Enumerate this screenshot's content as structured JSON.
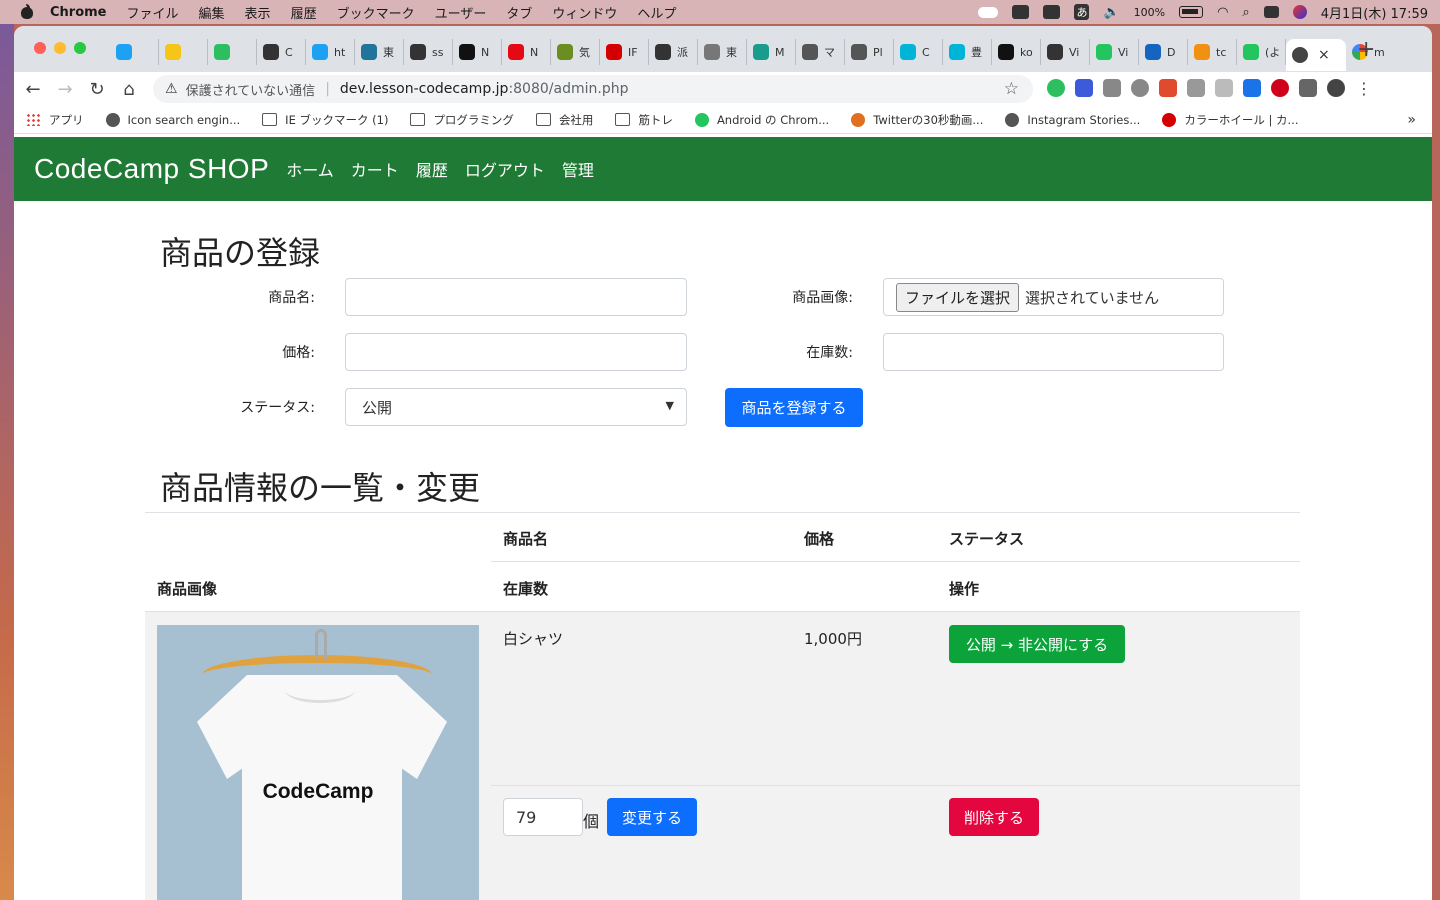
{
  "menubar": {
    "app": "Chrome",
    "items": [
      "ファイル",
      "編集",
      "表示",
      "履歴",
      "ブックマーク",
      "ユーザー",
      "タブ",
      "ウィンドウ",
      "ヘルプ"
    ],
    "battery": "100%",
    "ime": "あ",
    "clock": "4月1日(木) 17:59"
  },
  "tabs": [
    {
      "label": "",
      "icon": "twitter-icon",
      "color": "#1da1f2"
    },
    {
      "label": "",
      "icon": "notes-icon",
      "color": "#f5c518"
    },
    {
      "label": "",
      "icon": "evernote-icon",
      "color": "#2dbe60"
    },
    {
      "label": "C",
      "icon": "circle-icon",
      "color": "#333"
    },
    {
      "label": "ht",
      "icon": "twitter-icon",
      "color": "#1da1f2"
    },
    {
      "label": "東",
      "icon": "wordpress-icon",
      "color": "#21759b"
    },
    {
      "label": "ss",
      "icon": "book-icon",
      "color": "#333"
    },
    {
      "label": "N",
      "icon": "notion-icon",
      "color": "#111"
    },
    {
      "label": "N",
      "icon": "netflix-icon",
      "color": "#e50914"
    },
    {
      "label": "気",
      "icon": "weather-icon",
      "color": "#6b8e23"
    },
    {
      "label": "IF",
      "icon": "ipa-icon",
      "color": "#d40000"
    },
    {
      "label": "派",
      "icon": "t-icon",
      "color": "#333"
    },
    {
      "label": "東",
      "icon": "flag-icon",
      "color": "#777"
    },
    {
      "label": "M",
      "icon": "m-icon",
      "color": "#1a9c8c"
    },
    {
      "label": "マ",
      "icon": "globe-icon",
      "color": "#555"
    },
    {
      "label": "Pl",
      "icon": "globe-icon",
      "color": "#555"
    },
    {
      "label": "C",
      "icon": "codecamp-icon",
      "color": "#00b4d8"
    },
    {
      "label": "豊",
      "icon": "codecamp-icon",
      "color": "#00b4d8"
    },
    {
      "label": "ko",
      "icon": "github-icon",
      "color": "#111"
    },
    {
      "label": "Vi",
      "icon": "bug-icon",
      "color": "#333"
    },
    {
      "label": "Vi",
      "icon": "line-icon",
      "color": "#22c55e"
    },
    {
      "label": "D",
      "icon": "chart-icon",
      "color": "#1565c0"
    },
    {
      "label": "tc",
      "icon": "pma-icon",
      "color": "#f29111"
    },
    {
      "label": "(よ",
      "icon": "line-icon",
      "color": "#22c55e"
    }
  ],
  "active_tab": {
    "icon": "globe-icon",
    "close": "×"
  },
  "extra_tab": {
    "label": "m",
    "icon": "google-icon"
  },
  "new_tab": "+",
  "nav": {
    "back": "←",
    "forward": "→",
    "reload": "↻",
    "home": "⌂"
  },
  "address": {
    "warning_icon": "⚠",
    "security_text": "保護されていない通信",
    "host": "dev.lesson-codecamp.jp",
    "path": ":8080/admin.php",
    "star": "☆"
  },
  "bookmarks": [
    {
      "label": "アプリ",
      "icon": "apps-grid-icon"
    },
    {
      "label": "Icon search engin...",
      "icon": "recycle-icon"
    },
    {
      "label": "IE ブックマーク (1)",
      "icon": "folder-icon"
    },
    {
      "label": "プログラミング",
      "icon": "folder-icon"
    },
    {
      "label": "会社用",
      "icon": "folder-icon"
    },
    {
      "label": "筋トレ",
      "icon": "folder-icon"
    },
    {
      "label": "Android の Chrom...",
      "icon": "line-icon"
    },
    {
      "label": "Twitterの30秒動画...",
      "icon": "arrow-icon"
    },
    {
      "label": "Instagram Stories...",
      "icon": "globe-icon"
    },
    {
      "label": "カラーホイール | カ...",
      "icon": "adobe-icon"
    }
  ],
  "bookmarks_more": "»",
  "site": {
    "logo": "CodeCamp SHOP",
    "nav": [
      "ホーム",
      "カート",
      "履歴",
      "ログアウト",
      "管理"
    ],
    "brand_color": "#1e7a34"
  },
  "register": {
    "title": "商品の登録",
    "name_label": "商品名:",
    "image_label": "商品画像:",
    "file_button": "ファイルを選択",
    "file_status": "選択されていません",
    "price_label": "価格:",
    "stock_label": "在庫数:",
    "status_label": "ステータス:",
    "status_value": "公開",
    "submit": "商品を登録する"
  },
  "list": {
    "title": "商品情報の一覧・変更",
    "headers": {
      "image": "商品画像",
      "name": "商品名",
      "price": "価格",
      "status": "ステータス",
      "stock": "在庫数",
      "action": "操作"
    },
    "rows": [
      {
        "name": "白シャツ",
        "price": "1,000円",
        "status_button": "公開 → 非公開にする",
        "stock": "79",
        "unit": "個",
        "update_button": "変更する",
        "delete_button": "削除する",
        "image_text": "CodeCamp"
      }
    ]
  }
}
